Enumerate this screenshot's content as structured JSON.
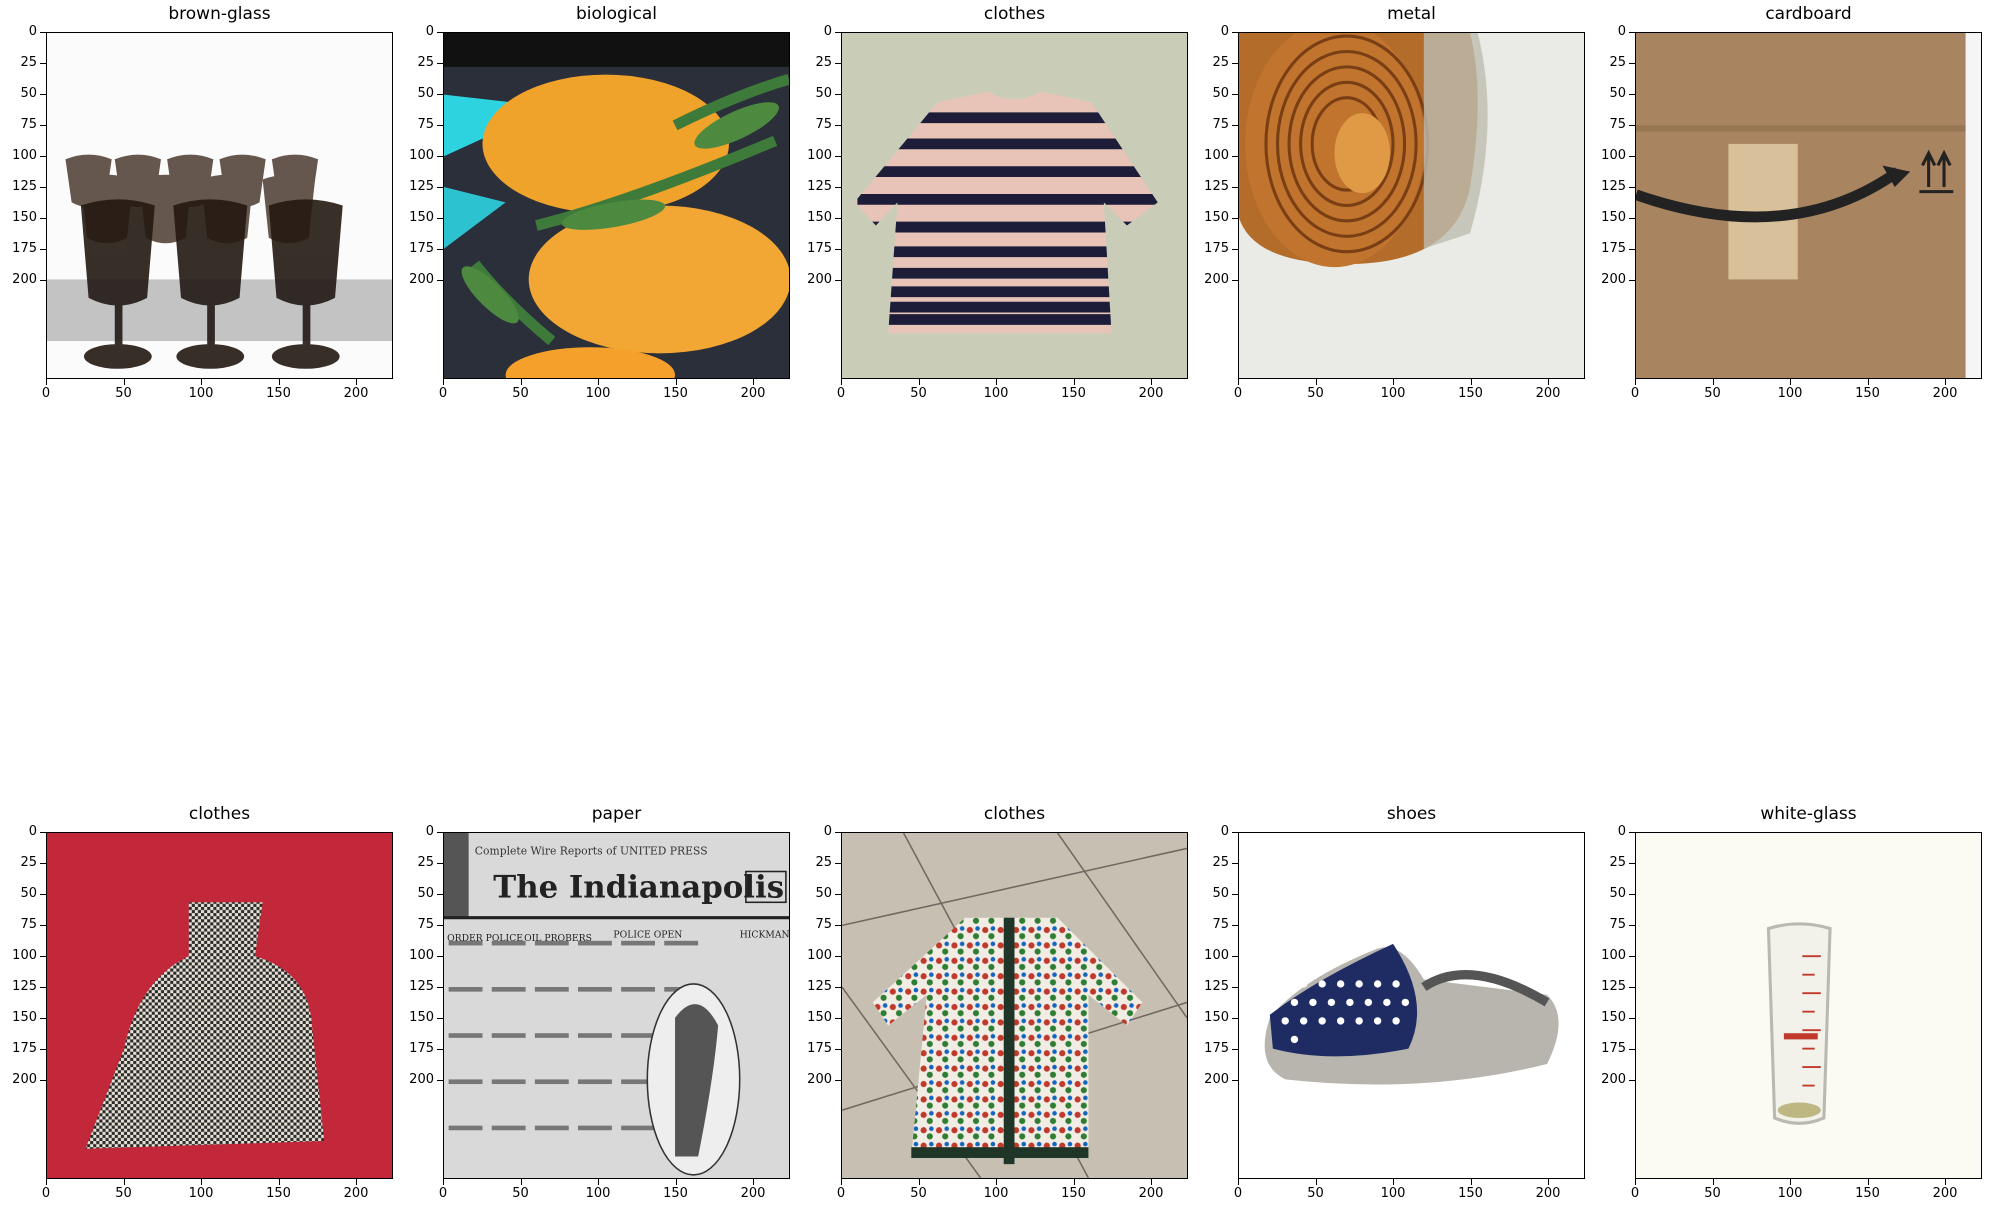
{
  "axis": {
    "y_ticks": [
      "0",
      "25",
      "50",
      "75",
      "100",
      "125",
      "150",
      "175",
      "200"
    ],
    "x_ticks": [
      "0",
      "50",
      "100",
      "150",
      "200"
    ]
  },
  "panels": [
    {
      "title": "brown-glass",
      "image": "brown-glass-goblets-photo"
    },
    {
      "title": "biological",
      "image": "oranges-on-leaves-photo"
    },
    {
      "title": "clothes",
      "image": "striped-shirt-photo"
    },
    {
      "title": "metal",
      "image": "tin-can-photo"
    },
    {
      "title": "cardboard",
      "image": "cardboard-box-photo"
    },
    {
      "title": "clothes",
      "image": "houndstooth-top-on-red-photo"
    },
    {
      "title": "paper",
      "image": "the-indianapolis-times-newspaper-photo",
      "image_text": "The Indianapolis Times"
    },
    {
      "title": "clothes",
      "image": "floral-cardigan-on-tiles-photo"
    },
    {
      "title": "shoes",
      "image": "polka-dot-slipper-photo"
    },
    {
      "title": "white-glass",
      "image": "measuring-glass-photo"
    }
  ]
}
